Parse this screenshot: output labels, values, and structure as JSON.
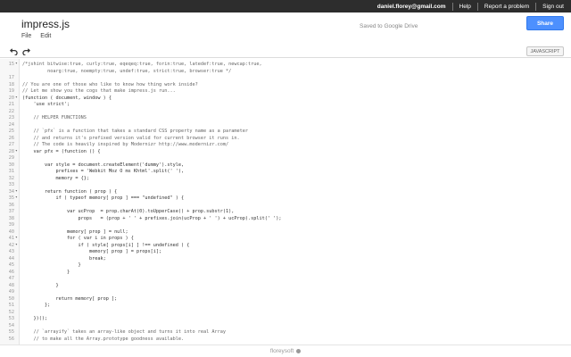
{
  "topbar": {
    "email": "daniel.florey@gmail.com",
    "help": "Help",
    "report": "Report a problem",
    "signout": "Sign out"
  },
  "header": {
    "title": "impress.js",
    "menu": [
      "File",
      "Edit"
    ],
    "saved": "Saved to Google Drive",
    "share": "Share"
  },
  "toolbar": {
    "undo_icon": "undo-icon",
    "redo_icon": "redo-icon",
    "mode": "JAVASCRIPT"
  },
  "editor": {
    "lines": [
      {
        "n": "15",
        "fold": true,
        "code": "/*jshint bitwise:true, curly:true, eqeqeq:true, forin:true, latedef:true, newcap:true,",
        "comment": true
      },
      {
        "n": "",
        "fold": false,
        "code": "         noarg:true, noempty:true, undef:true, strict:true, browser:true */",
        "comment": true
      },
      {
        "n": "17",
        "fold": false,
        "code": "",
        "comment": false
      },
      {
        "n": "18",
        "fold": false,
        "code": "// You are one of those who like to know how thing work inside?",
        "comment": true
      },
      {
        "n": "19",
        "fold": false,
        "code": "// Let me show you the cogs that make impress.js run...",
        "comment": true
      },
      {
        "n": "20",
        "fold": true,
        "code": "(function ( document, window ) {",
        "comment": false
      },
      {
        "n": "21",
        "fold": false,
        "code": "    'use strict';",
        "comment": false
      },
      {
        "n": "22",
        "fold": false,
        "code": "",
        "comment": false
      },
      {
        "n": "23",
        "fold": false,
        "code": "    // HELPER FUNCTIONS",
        "comment": true
      },
      {
        "n": "24",
        "fold": false,
        "code": "",
        "comment": false
      },
      {
        "n": "25",
        "fold": false,
        "code": "    // `pfx` is a function that takes a standard CSS property name as a parameter",
        "comment": true
      },
      {
        "n": "26",
        "fold": false,
        "code": "    // and returns it's prefixed version valid for current browser it runs in.",
        "comment": true
      },
      {
        "n": "27",
        "fold": false,
        "code": "    // The code is heavily inspired by Modernizr http://www.modernizr.com/",
        "comment": true
      },
      {
        "n": "28",
        "fold": true,
        "code": "    var pfx = (function () {",
        "comment": false
      },
      {
        "n": "29",
        "fold": false,
        "code": "",
        "comment": false
      },
      {
        "n": "30",
        "fold": false,
        "code": "        var style = document.createElement('dummy').style,",
        "comment": false
      },
      {
        "n": "31",
        "fold": false,
        "code": "            prefixes = 'Webkit Moz O ms Khtml'.split(' '),",
        "comment": false
      },
      {
        "n": "32",
        "fold": false,
        "code": "            memory = {};",
        "comment": false
      },
      {
        "n": "33",
        "fold": false,
        "code": "",
        "comment": false
      },
      {
        "n": "34",
        "fold": true,
        "code": "        return function ( prop ) {",
        "comment": false
      },
      {
        "n": "35",
        "fold": true,
        "code": "            if ( typeof memory[ prop ] === \"undefined\" ) {",
        "comment": false
      },
      {
        "n": "36",
        "fold": false,
        "code": "",
        "comment": false
      },
      {
        "n": "37",
        "fold": false,
        "code": "                var ucProp  = prop.charAt(0).toUpperCase() + prop.substr(1),",
        "comment": false
      },
      {
        "n": "38",
        "fold": false,
        "code": "                    props   = (prop + ' ' + prefixes.join(ucProp + ' ') + ucProp).split(' ');",
        "comment": false
      },
      {
        "n": "39",
        "fold": false,
        "code": "",
        "comment": false
      },
      {
        "n": "40",
        "fold": false,
        "code": "                memory[ prop ] = null;",
        "comment": false
      },
      {
        "n": "41",
        "fold": true,
        "code": "                for ( var i in props ) {",
        "comment": false
      },
      {
        "n": "42",
        "fold": true,
        "code": "                    if ( style[ props[i] ] !== undefined ) {",
        "comment": false
      },
      {
        "n": "43",
        "fold": false,
        "code": "                        memory[ prop ] = props[i];",
        "comment": false
      },
      {
        "n": "44",
        "fold": false,
        "code": "                        break;",
        "comment": false
      },
      {
        "n": "45",
        "fold": false,
        "code": "                    }",
        "comment": false
      },
      {
        "n": "46",
        "fold": false,
        "code": "                }",
        "comment": false
      },
      {
        "n": "47",
        "fold": false,
        "code": "",
        "comment": false
      },
      {
        "n": "48",
        "fold": false,
        "code": "            }",
        "comment": false
      },
      {
        "n": "49",
        "fold": false,
        "code": "",
        "comment": false
      },
      {
        "n": "50",
        "fold": false,
        "code": "            return memory[ prop ];",
        "comment": false
      },
      {
        "n": "51",
        "fold": false,
        "code": "        };",
        "comment": false
      },
      {
        "n": "52",
        "fold": false,
        "code": "",
        "comment": false
      },
      {
        "n": "53",
        "fold": false,
        "code": "    })();",
        "comment": false
      },
      {
        "n": "54",
        "fold": false,
        "code": "",
        "comment": false
      },
      {
        "n": "55",
        "fold": false,
        "code": "    // `arrayify` takes an array-like object and turns it into real Array",
        "comment": true
      },
      {
        "n": "56",
        "fold": false,
        "code": "    // to make all the Array.prototype goodness available.",
        "comment": true
      }
    ]
  },
  "footer": {
    "brand": "floreysoft"
  }
}
